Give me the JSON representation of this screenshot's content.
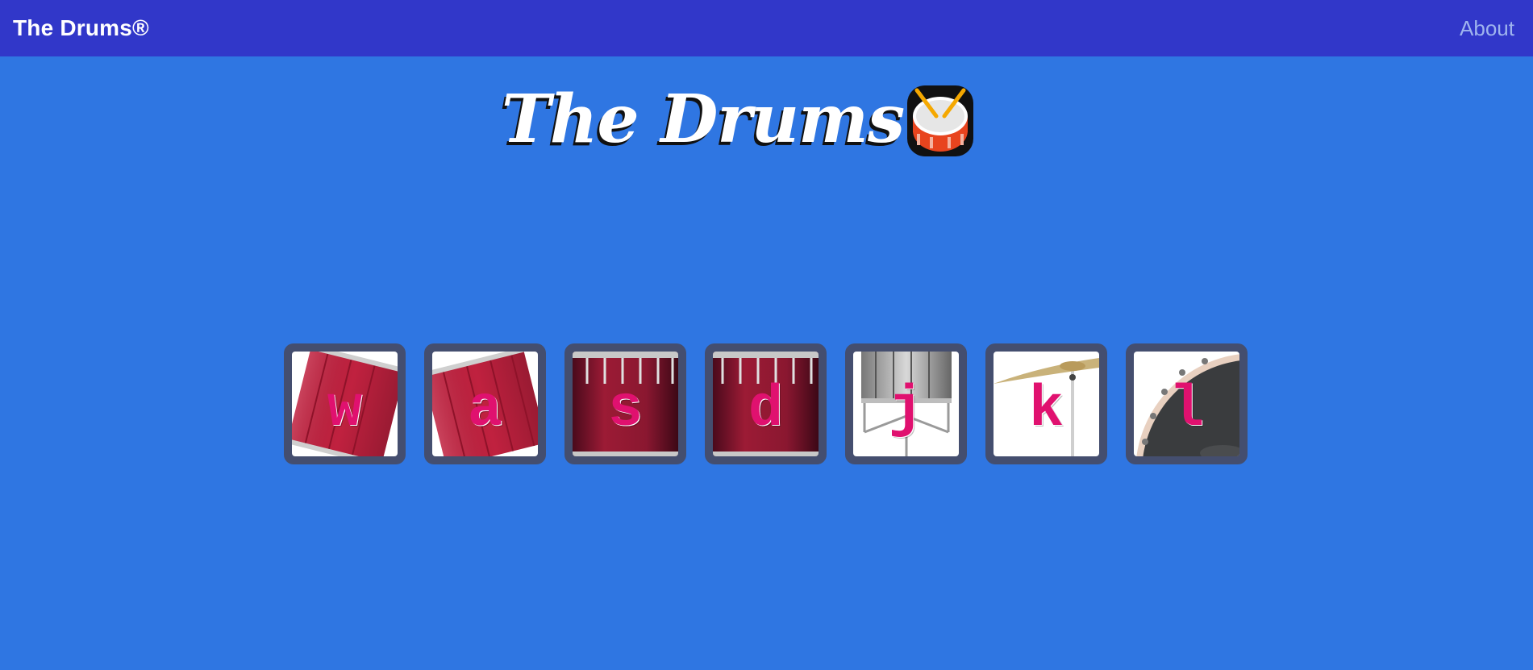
{
  "navbar": {
    "brand": "The Drums®",
    "about_label": "About",
    "color": "#3137c9"
  },
  "header": {
    "title": "The Drums",
    "icon": "drum-icon"
  },
  "background_color": "#2f76e2",
  "drum_keys": [
    {
      "key": "w",
      "instrument": "tom-1-icon"
    },
    {
      "key": "a",
      "instrument": "tom-2-icon"
    },
    {
      "key": "s",
      "instrument": "floor-tom-1-icon"
    },
    {
      "key": "d",
      "instrument": "floor-tom-2-icon"
    },
    {
      "key": "j",
      "instrument": "snare-icon"
    },
    {
      "key": "k",
      "instrument": "crash-cymbal-icon"
    },
    {
      "key": "l",
      "instrument": "bass-drum-icon"
    }
  ],
  "accent_color": "#e0116f"
}
